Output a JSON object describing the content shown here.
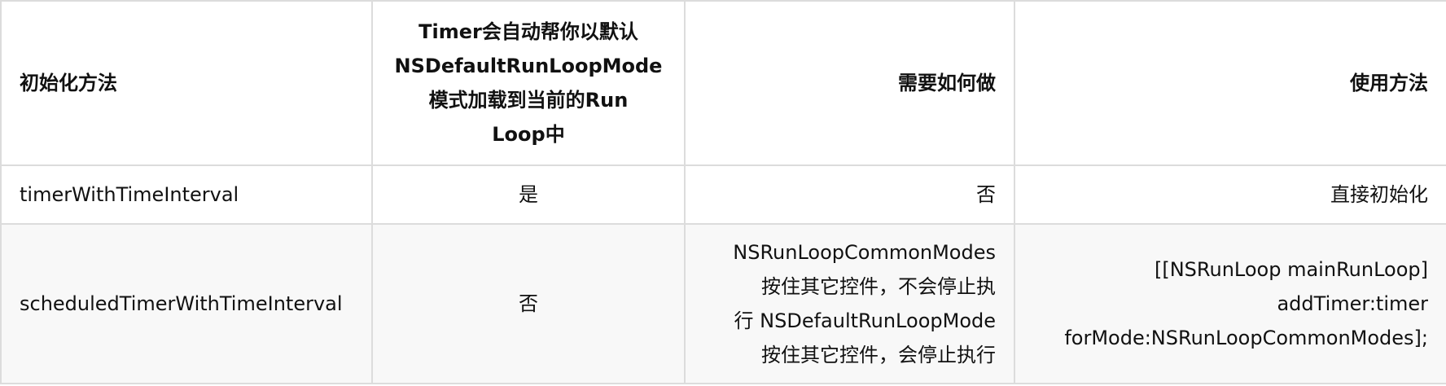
{
  "table": {
    "headers": [
      [
        "初始化方法"
      ],
      [
        "Timer会自动帮你以默认",
        "NSDefaultRunLoopMode",
        "模式加载到当前的Run",
        "Loop中"
      ],
      [
        "需要如何做"
      ],
      [
        "使用方法"
      ]
    ],
    "rows": [
      [
        [
          "timerWithTimeInterval"
        ],
        [
          "是"
        ],
        [
          "否"
        ],
        [
          "直接初始化"
        ]
      ],
      [
        [
          "scheduledTimerWithTimeInterval"
        ],
        [
          "否"
        ],
        [
          "NSRunLoopCommonModes",
          "按住其它控件，不会停止执",
          "行 NSDefaultRunLoopMode",
          "按住其它控件，会停止执行"
        ],
        [
          "[[NSRunLoop mainRunLoop]",
          "addTimer:timer",
          "forMode:NSRunLoopCommonModes];"
        ]
      ]
    ]
  }
}
